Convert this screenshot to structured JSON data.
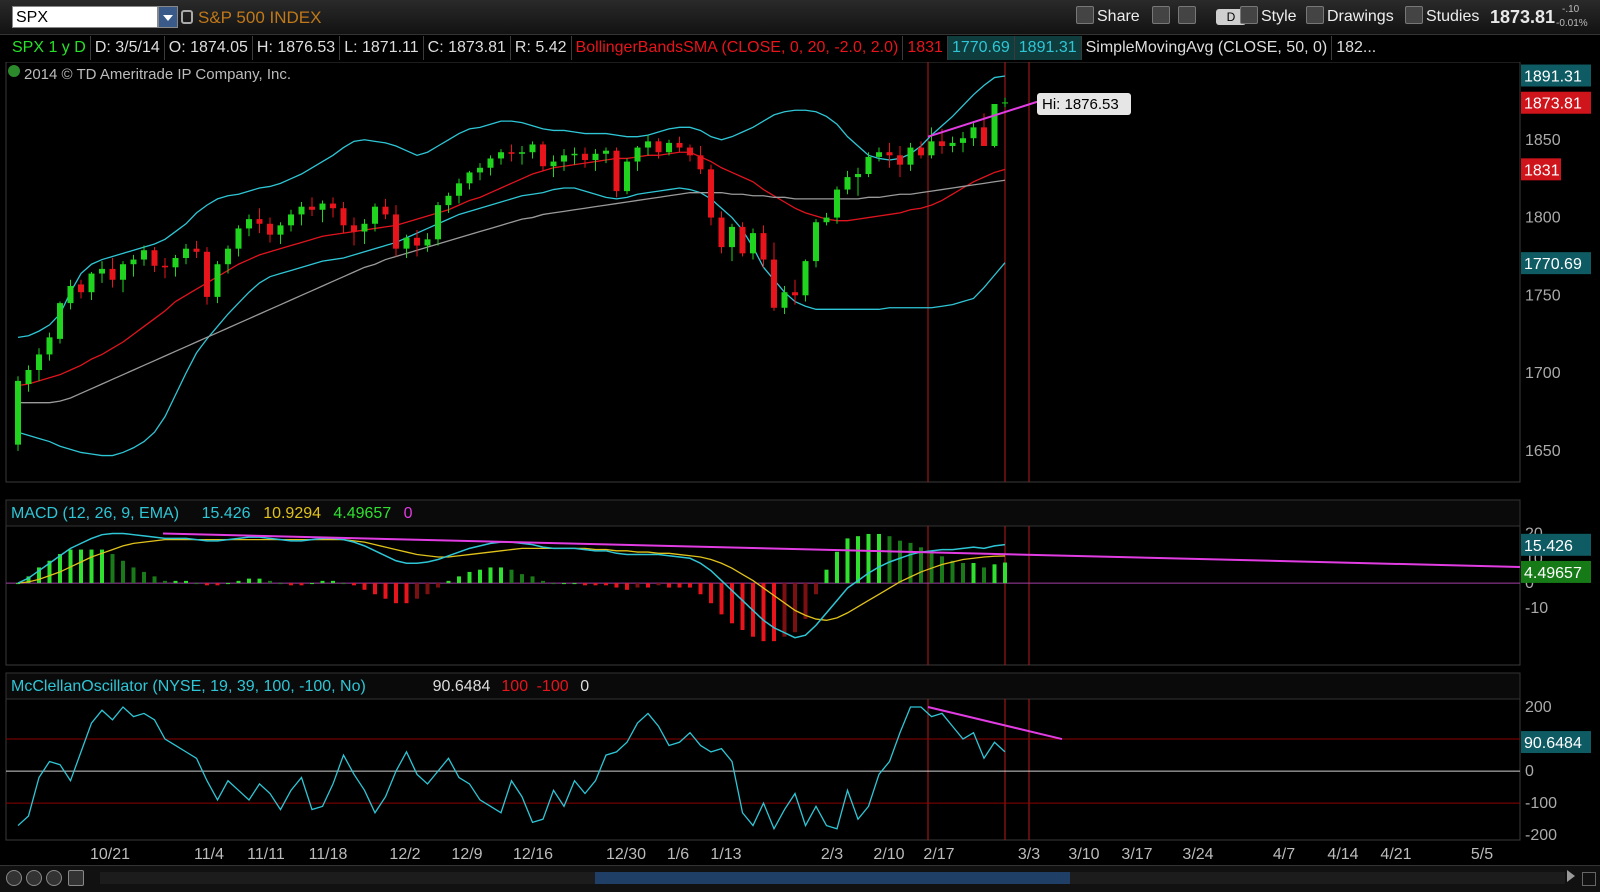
{
  "header": {
    "symbol": "SPX",
    "index_name": "S&P 500 INDEX",
    "share_label": "Share",
    "aggregation_badge": "D",
    "style_label": "Style",
    "drawings_label": "Drawings",
    "studies_label": "Studies",
    "last_price": "1873.81",
    "change_abs": "-.10",
    "change_pct": "-0.01%"
  },
  "infobar": {
    "period": "SPX 1 y D",
    "date": "D: 3/5/14",
    "open": "O: 1874.05",
    "high": "H: 1876.53",
    "low": "L: 1871.11",
    "close": "C: 1873.81",
    "range": "R: 5.42",
    "bb_name": "BollingerBandsSMA (CLOSE, 0, 20, -2.0, 2.0)",
    "bb_mid": "1831",
    "bb_low": "1770.69",
    "bb_up": "1891.31",
    "sma_name": "SimpleMovingAvg (CLOSE, 50, 0)",
    "sma_val": "182..."
  },
  "copyright": "2014 © TD Ameritrade IP Company, Inc.",
  "hi_label": "Hi: 1876.53",
  "colors": {
    "bull": "#1fd31f",
    "bear": "#e8141c",
    "bb_band": "#2ec6d6",
    "bb_mid": "#e0141e",
    "sma": "#9a9a9a",
    "trendline": "#e23ce3",
    "macd": "#2ec6d6",
    "signal": "#e0c21a",
    "mcclellan": "#2ec6d6",
    "grid_h": "#8b0000",
    "vline": "#b71c1c"
  },
  "chart_data": [
    {
      "type": "candlestick",
      "title": "SPX 1 y D",
      "price_axis_ticks": [
        1650,
        1700,
        1750,
        1800,
        1850
      ],
      "ylim": [
        1630,
        1900
      ],
      "x_axis_ticks": [
        "10/21",
        "11/4",
        "11/11",
        "11/18",
        "12/2",
        "12/9",
        "12/16",
        "12/30",
        "1/6",
        "1/13",
        "2/3",
        "2/10",
        "2/17",
        "3/3",
        "3/10",
        "3/17",
        "3/24",
        "4/7",
        "4/14",
        "4/21",
        "5/5"
      ],
      "price_labels": {
        "bb_upper": "1891.31",
        "last": "1873.81",
        "bb_mid": "1831",
        "bb_lower": "1770.69"
      },
      "ohlc": [
        [
          1654,
          1698,
          1650,
          1695
        ],
        [
          1693,
          1705,
          1688,
          1702
        ],
        [
          1702,
          1716,
          1695,
          1712
        ],
        [
          1712,
          1726,
          1708,
          1723
        ],
        [
          1722,
          1746,
          1719,
          1745
        ],
        [
          1745,
          1760,
          1741,
          1756
        ],
        [
          1757,
          1760,
          1748,
          1752
        ],
        [
          1752,
          1765,
          1747,
          1764
        ],
        [
          1764,
          1772,
          1758,
          1767
        ],
        [
          1767,
          1774,
          1755,
          1760
        ],
        [
          1760,
          1772,
          1752,
          1770
        ],
        [
          1770,
          1776,
          1762,
          1773
        ],
        [
          1773,
          1782,
          1769,
          1779
        ],
        [
          1779,
          1781,
          1765,
          1769
        ],
        [
          1769,
          1774,
          1761,
          1768
        ],
        [
          1768,
          1776,
          1762,
          1774
        ],
        [
          1774,
          1783,
          1770,
          1780
        ],
        [
          1780,
          1785,
          1774,
          1778
        ],
        [
          1778,
          1781,
          1744,
          1749
        ],
        [
          1749,
          1772,
          1745,
          1770
        ],
        [
          1770,
          1782,
          1764,
          1780
        ],
        [
          1780,
          1795,
          1775,
          1793
        ],
        [
          1793,
          1802,
          1788,
          1799
        ],
        [
          1799,
          1806,
          1790,
          1796
        ],
        [
          1796,
          1800,
          1784,
          1789
        ],
        [
          1789,
          1797,
          1783,
          1795
        ],
        [
          1795,
          1805,
          1791,
          1802
        ],
        [
          1802,
          1810,
          1795,
          1807
        ],
        [
          1807,
          1813,
          1801,
          1805
        ],
        [
          1805,
          1811,
          1797,
          1809
        ],
        [
          1809,
          1813,
          1800,
          1806
        ],
        [
          1806,
          1810,
          1790,
          1795
        ],
        [
          1795,
          1800,
          1782,
          1791
        ],
        [
          1791,
          1799,
          1783,
          1796
        ],
        [
          1796,
          1809,
          1791,
          1807
        ],
        [
          1807,
          1812,
          1799,
          1802
        ],
        [
          1802,
          1808,
          1775,
          1780
        ],
        [
          1780,
          1789,
          1774,
          1787
        ],
        [
          1787,
          1792,
          1775,
          1782
        ],
        [
          1782,
          1790,
          1778,
          1786
        ],
        [
          1786,
          1810,
          1782,
          1808
        ],
        [
          1808,
          1816,
          1803,
          1814
        ],
        [
          1814,
          1825,
          1809,
          1822
        ],
        [
          1822,
          1830,
          1818,
          1829
        ],
        [
          1829,
          1835,
          1824,
          1832
        ],
        [
          1832,
          1840,
          1827,
          1838
        ],
        [
          1838,
          1844,
          1834,
          1842
        ],
        [
          1842,
          1847,
          1836,
          1841
        ],
        [
          1841,
          1846,
          1834,
          1842
        ],
        [
          1842,
          1849,
          1838,
          1847
        ],
        [
          1847,
          1849,
          1830,
          1833
        ],
        [
          1833,
          1840,
          1826,
          1836
        ],
        [
          1836,
          1844,
          1830,
          1840
        ],
        [
          1840,
          1845,
          1834,
          1841
        ],
        [
          1841,
          1845,
          1832,
          1837
        ],
        [
          1837,
          1844,
          1830,
          1841
        ],
        [
          1841,
          1845,
          1835,
          1843
        ],
        [
          1843,
          1845,
          1813,
          1817
        ],
        [
          1817,
          1838,
          1815,
          1836
        ],
        [
          1836,
          1846,
          1830,
          1845
        ],
        [
          1845,
          1853,
          1840,
          1849
        ],
        [
          1849,
          1851,
          1838,
          1842
        ],
        [
          1842,
          1850,
          1840,
          1848
        ],
        [
          1848,
          1852,
          1842,
          1845
        ],
        [
          1845,
          1847,
          1836,
          1840
        ],
        [
          1840,
          1846,
          1828,
          1831
        ],
        [
          1831,
          1834,
          1795,
          1800
        ],
        [
          1800,
          1804,
          1777,
          1781
        ],
        [
          1781,
          1796,
          1772,
          1794
        ],
        [
          1794,
          1797,
          1775,
          1777
        ],
        [
          1777,
          1793,
          1773,
          1790
        ],
        [
          1790,
          1795,
          1768,
          1773
        ],
        [
          1773,
          1784,
          1740,
          1742
        ],
        [
          1742,
          1756,
          1738,
          1752
        ],
        [
          1752,
          1760,
          1744,
          1750
        ],
        [
          1750,
          1773,
          1746,
          1772
        ],
        [
          1772,
          1799,
          1768,
          1797
        ],
        [
          1797,
          1803,
          1795,
          1800
        ],
        [
          1800,
          1820,
          1796,
          1818
        ],
        [
          1818,
          1830,
          1815,
          1826
        ],
        [
          1826,
          1832,
          1814,
          1828
        ],
        [
          1828,
          1842,
          1826,
          1839
        ],
        [
          1839,
          1845,
          1836,
          1842
        ],
        [
          1842,
          1848,
          1832,
          1840
        ],
        [
          1840,
          1846,
          1826,
          1834
        ],
        [
          1834,
          1848,
          1830,
          1845
        ],
        [
          1845,
          1849,
          1838,
          1840
        ],
        [
          1840,
          1858,
          1838,
          1849
        ],
        [
          1849,
          1857,
          1841,
          1846
        ],
        [
          1846,
          1852,
          1842,
          1848
        ],
        [
          1848,
          1855,
          1842,
          1851
        ],
        [
          1851,
          1862,
          1846,
          1858
        ],
        [
          1858,
          1867,
          1846,
          1846
        ],
        [
          1846,
          1873,
          1845,
          1873
        ],
        [
          1874,
          1877,
          1871,
          1874
        ]
      ],
      "bb_upper": [
        1723,
        1724,
        1727,
        1731,
        1738,
        1752,
        1764,
        1770,
        1773,
        1775,
        1777,
        1779,
        1781,
        1783,
        1786,
        1791,
        1796,
        1803,
        1808,
        1812,
        1814,
        1815,
        1817,
        1819,
        1820,
        1822,
        1825,
        1828,
        1832,
        1836,
        1840,
        1845,
        1849,
        1850,
        1849,
        1848,
        1846,
        1843,
        1840,
        1842,
        1846,
        1850,
        1854,
        1857,
        1858,
        1860,
        1862,
        1862,
        1861,
        1859,
        1857,
        1856,
        1856,
        1855,
        1854,
        1854,
        1854,
        1853,
        1852,
        1852,
        1853,
        1855,
        1857,
        1858,
        1858,
        1856,
        1852,
        1850,
        1852,
        1855,
        1858,
        1862,
        1866,
        1868,
        1869,
        1869,
        1868,
        1865,
        1860,
        1852,
        1846,
        1840,
        1838,
        1837,
        1838,
        1841,
        1846,
        1853,
        1859,
        1865,
        1872,
        1879,
        1885,
        1890,
        1891
      ],
      "bb_mid": [
        1692,
        1693,
        1695,
        1697,
        1699,
        1702,
        1705,
        1709,
        1712,
        1716,
        1720,
        1725,
        1730,
        1735,
        1740,
        1746,
        1750,
        1754,
        1758,
        1762,
        1766,
        1770,
        1773,
        1776,
        1778,
        1780,
        1782,
        1784,
        1786,
        1788,
        1789,
        1790,
        1791,
        1792,
        1793,
        1794,
        1795,
        1797,
        1799,
        1801,
        1803,
        1805,
        1808,
        1811,
        1813,
        1816,
        1819,
        1822,
        1825,
        1828,
        1830,
        1832,
        1833,
        1834,
        1835,
        1836,
        1837,
        1838,
        1838,
        1839,
        1840,
        1840,
        1841,
        1842,
        1842,
        1839,
        1836,
        1832,
        1829,
        1826,
        1823,
        1818,
        1814,
        1810,
        1806,
        1803,
        1801,
        1799,
        1798,
        1798,
        1799,
        1800,
        1801,
        1802,
        1803,
        1805,
        1806,
        1808,
        1811,
        1815,
        1819,
        1823,
        1826,
        1829,
        1831
      ],
      "sma50": [
        1681,
        1681,
        1681,
        1681,
        1682,
        1684,
        1687,
        1690,
        1693,
        1696,
        1699,
        1702,
        1705,
        1708,
        1711,
        1714,
        1717,
        1720,
        1723,
        1726,
        1729,
        1732,
        1735,
        1738,
        1741,
        1744,
        1747,
        1750,
        1753,
        1756,
        1759,
        1762,
        1765,
        1768,
        1770,
        1773,
        1775,
        1777,
        1779,
        1781,
        1783,
        1785,
        1787,
        1789,
        1791,
        1793,
        1795,
        1797,
        1799,
        1800,
        1802,
        1803,
        1804,
        1805,
        1806,
        1807,
        1808,
        1809,
        1810,
        1811,
        1812,
        1813,
        1814,
        1815,
        1816,
        1816,
        1816,
        1816,
        1815,
        1815,
        1814,
        1814,
        1813,
        1813,
        1812,
        1812,
        1812,
        1812,
        1812,
        1812,
        1812,
        1813,
        1813,
        1814,
        1815,
        1815,
        1816,
        1817,
        1818,
        1819,
        1820,
        1821,
        1822,
        1823,
        1824
      ],
      "bb_lower": [
        1662,
        1660,
        1658,
        1656,
        1653,
        1651,
        1649,
        1648,
        1647,
        1647,
        1649,
        1652,
        1656,
        1662,
        1672,
        1686,
        1700,
        1713,
        1722,
        1730,
        1738,
        1745,
        1752,
        1758,
        1762,
        1764,
        1766,
        1768,
        1770,
        1772,
        1773,
        1774,
        1776,
        1778,
        1780,
        1782,
        1784,
        1787,
        1790,
        1793,
        1796,
        1799,
        1802,
        1804,
        1806,
        1808,
        1810,
        1812,
        1814,
        1815,
        1816,
        1818,
        1819,
        1819,
        1817,
        1815,
        1813,
        1812,
        1813,
        1815,
        1816,
        1817,
        1818,
        1819,
        1818,
        1816,
        1812,
        1806,
        1800,
        1792,
        1781,
        1768,
        1760,
        1752,
        1746,
        1743,
        1741,
        1741,
        1741,
        1741,
        1741,
        1741,
        1741,
        1742,
        1742,
        1742,
        1742,
        1742,
        1743,
        1744,
        1746,
        1748,
        1755,
        1763,
        1771
      ]
    },
    {
      "type": "line+bar",
      "title": "MACD (12, 26, 9, EMA)",
      "values": {
        "value": "15.426",
        "avg": "10.9294",
        "diff": "4.49657",
        "zero": "0"
      },
      "ylim": [
        -33,
        23
      ],
      "y_ticks": [
        20,
        10,
        0,
        -10
      ],
      "macd": [
        0,
        2,
        5,
        8,
        11,
        14,
        16,
        18,
        19.5,
        20,
        20,
        19.5,
        19,
        18.5,
        18,
        18,
        18,
        17.5,
        17,
        17,
        17.5,
        18,
        18.5,
        18.5,
        18,
        17.5,
        17,
        17,
        17.5,
        18,
        18,
        17.5,
        16.5,
        15,
        13,
        11,
        9,
        8,
        8,
        8.5,
        9.5,
        11,
        12.5,
        14,
        15,
        16,
        16.5,
        16.5,
        16,
        15.5,
        14.5,
        14,
        14,
        14,
        13.5,
        13,
        13,
        12,
        11.5,
        11.5,
        11.5,
        11.5,
        11,
        10.5,
        10,
        8,
        5,
        1,
        -3,
        -7,
        -11,
        -15,
        -18,
        -20,
        -22,
        -21,
        -17,
        -12,
        -7,
        -2,
        1,
        4,
        6.5,
        8.5,
        10,
        11.5,
        12.5,
        13,
        13.5,
        13.5,
        14,
        14.5,
        14,
        15,
        15.5
      ],
      "signal": [
        0,
        0.5,
        1.5,
        3,
        4.5,
        6.5,
        8.5,
        10.5,
        12,
        13.5,
        15,
        16,
        16.5,
        17,
        17.5,
        17.5,
        17.5,
        17.5,
        17.5,
        17.5,
        17.5,
        17.5,
        17.5,
        17.5,
        17.5,
        17.5,
        17.5,
        17.5,
        17.5,
        17.5,
        17.5,
        17.5,
        17,
        16.5,
        15.5,
        14.5,
        13.5,
        12.5,
        11.5,
        11,
        10.5,
        10.5,
        11,
        11.5,
        12,
        12.5,
        13,
        13.5,
        14,
        14,
        14,
        14,
        14,
        14,
        14,
        13.5,
        13.5,
        13,
        13,
        12.5,
        12.5,
        12,
        12,
        11.5,
        11,
        10.5,
        9.5,
        8,
        6,
        3.5,
        1,
        -2,
        -5,
        -8,
        -11,
        -13,
        -14.5,
        -15,
        -14,
        -12,
        -9.5,
        -7,
        -4.5,
        -2,
        0.5,
        2.5,
        4.5,
        6,
        7.5,
        8.5,
        9.5,
        10,
        10.5,
        10.8,
        10.9
      ]
    },
    {
      "type": "line",
      "title": "McClellanOscillator (NYSE, 19, 39, 100, -100, No)",
      "values": {
        "value": "90.6484",
        "upper": "100",
        "lower": "-100",
        "zero": "0"
      },
      "ylim": [
        -215,
        225
      ],
      "y_ticks": [
        200,
        100,
        0,
        -100,
        -200
      ],
      "series": [
        -170,
        -140,
        -20,
        30,
        20,
        -30,
        60,
        150,
        190,
        160,
        200,
        170,
        180,
        160,
        100,
        80,
        60,
        40,
        -30,
        -90,
        -30,
        -60,
        -90,
        -40,
        -70,
        -120,
        -60,
        -20,
        -120,
        -110,
        -40,
        50,
        -10,
        -60,
        -130,
        -80,
        0,
        60,
        -10,
        -40,
        0,
        40,
        -20,
        -40,
        -90,
        -110,
        -130,
        -30,
        -80,
        -160,
        -150,
        -60,
        -110,
        -30,
        -70,
        -30,
        50,
        60,
        90,
        150,
        180,
        140,
        80,
        90,
        120,
        80,
        60,
        70,
        30,
        -130,
        -170,
        -100,
        -180,
        -120,
        -70,
        -170,
        -110,
        -170,
        -180,
        -60,
        -150,
        -110,
        -10,
        30,
        120,
        200,
        200,
        170,
        180,
        140,
        100,
        120,
        40,
        90,
        60
      ]
    }
  ]
}
